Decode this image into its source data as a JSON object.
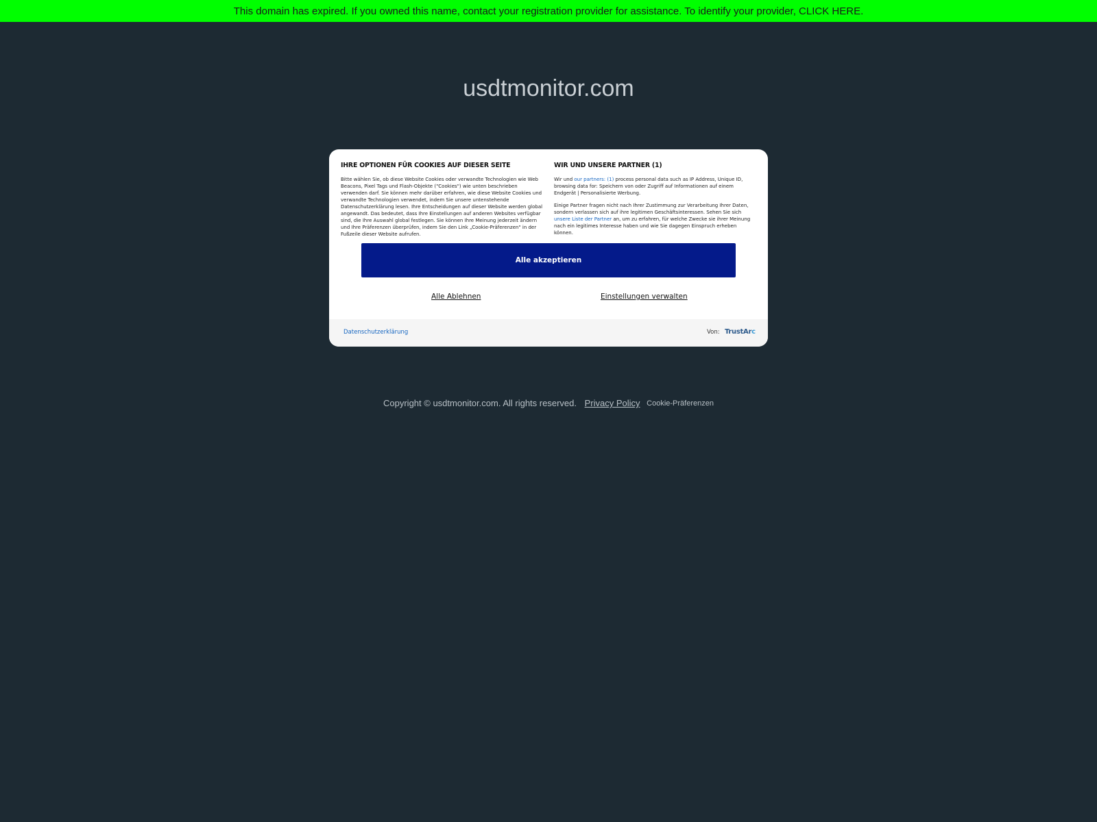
{
  "banner": {
    "text": "This domain has expired. If you owned this name, contact your registration provider for assistance. To identify your provider, CLICK HERE."
  },
  "domain_title": "usdtmonitor.com",
  "cookie_modal": {
    "left_heading": "IHRE OPTIONEN FÜR COOKIES AUF DIESER SEITE",
    "left_text": "Bitte wählen Sie, ob diese Website Cookies oder verwandte Technologien wie Web Beacons, Pixel Tags und Flash-Objekte (\"Cookies\") wie unten beschrieben verwenden darf. Sie können mehr darüber erfahren, wie diese Website Cookies und verwandte Technologien verwendet, indem Sie unsere untenstehende Datenschutzerklärung lesen. Ihre Entscheidungen auf dieser Website werden global angewandt. Das bedeutet, dass Ihre Einstellungen auf anderen Websites verfügbar sind, die Ihre Auswahl global festlegen. Sie können Ihre Meinung jederzeit ändern und Ihre Präferenzen überprüfen, indem Sie den Link „Cookie-Präferenzen\" in der Fußzeile dieser Website aufrufen.",
    "right_heading": "WIR UND UNSERE PARTNER (1)",
    "right_p1_pre": "Wir und ",
    "right_p1_link": "our partners: (1)",
    "right_p1_post": " process personal data such as IP Address, Unique ID, browsing data for: Speichern von oder Zugriff auf Informationen auf einem Endgerät | Personalisierte Werbung.",
    "right_p2_pre": "Einige Partner fragen nicht nach Ihrer Zustimmung zur Verarbeitung Ihrer Daten, sondern verlassen sich auf ihre legitimen Geschäftsinteressen. Sehen Sie sich ",
    "right_p2_link": "unsere Liste der Partner",
    "right_p2_post": " an, um zu erfahren, für welche Zwecke sie ihrer Meinung nach ein legitimes Interesse haben und wie Sie dagegen Einspruch erheben können.",
    "accept_label": "Alle akzeptieren",
    "reject_label": "Alle Ablehnen",
    "manage_label": "Einstellungen verwalten",
    "privacy_label": "Datenschutzerklärung",
    "by_label": "Von:",
    "logo_text_main": "TrustAr",
    "logo_text_accent": "c"
  },
  "footer": {
    "copyright": "Copyright © usdtmonitor.com.  All rights reserved.",
    "privacy": "Privacy Policy",
    "cookie_pref": "Cookie-Präferenzen"
  },
  "colors": {
    "background": "#1d2a33",
    "banner": "#00ff00",
    "accept_button": "#041a8a",
    "link": "#1565c0"
  }
}
